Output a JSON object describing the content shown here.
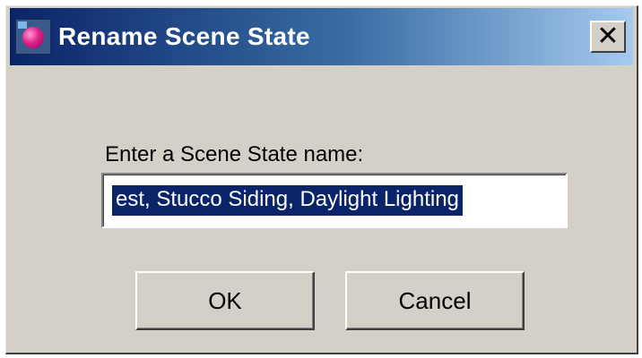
{
  "window": {
    "title": "Rename Scene State",
    "icon": "app-orb-icon",
    "close_label": "✕",
    "close_icon": "close-icon"
  },
  "form": {
    "prompt_label": "Enter a Scene State name:",
    "name_value": "est, Stucco Siding,  Daylight Lighting"
  },
  "buttons": {
    "ok_label": "OK",
    "cancel_label": "Cancel"
  },
  "colors": {
    "titlebar_start": "#0a246a",
    "titlebar_end": "#a6caf0",
    "dialog_bg": "#d4d0c8",
    "selection_bg": "#0a246a"
  }
}
